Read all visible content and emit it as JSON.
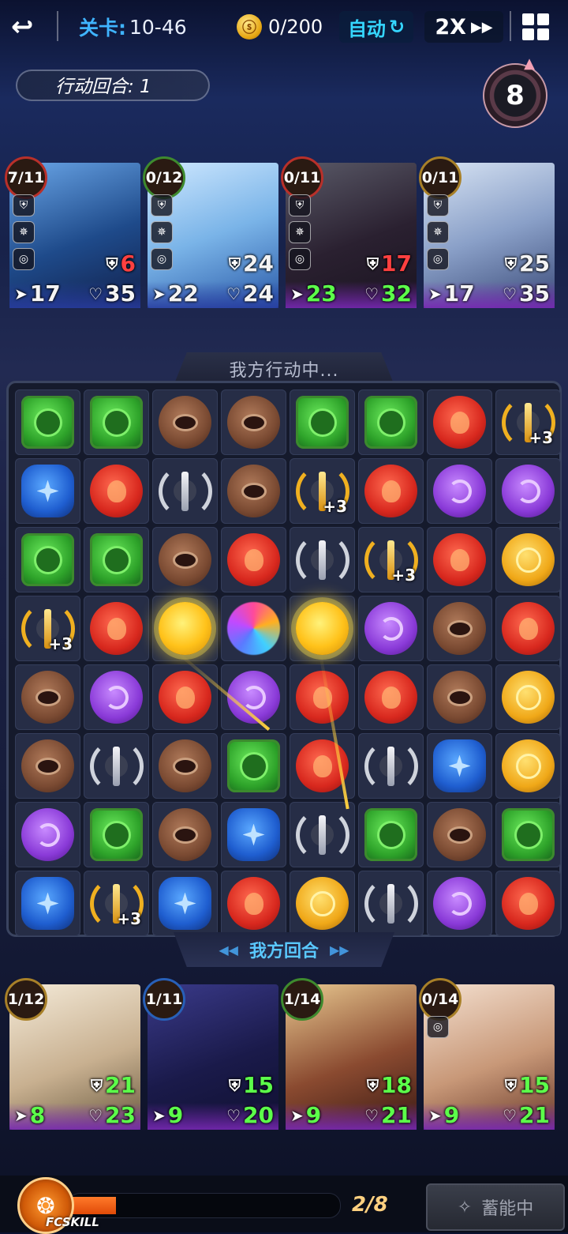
{
  "topbar": {
    "back_icon": "back-arrow-icon",
    "stage_label": "关卡:",
    "stage_value": "10-46",
    "coins": "0/200",
    "auto_label": "自动",
    "speed_label": "2X",
    "menu_icon": "grid-menu-icon"
  },
  "turn_label": "行动回合: 1",
  "round_counter": "8",
  "enemies": [
    {
      "energy": "7/11",
      "def": "6",
      "def_color": "red",
      "spd": "17",
      "hp": "35",
      "hp_color": "white",
      "spd_color": "white",
      "theme": "blue"
    },
    {
      "energy": "0/12",
      "def": "24",
      "def_color": "white",
      "spd": "22",
      "hp": "24",
      "hp_color": "white",
      "spd_color": "white",
      "theme": "blue"
    },
    {
      "energy": "0/11",
      "def": "17",
      "def_color": "red",
      "spd": "23",
      "hp": "32",
      "hp_color": "green",
      "spd_color": "green",
      "theme": "purple"
    },
    {
      "energy": "0/11",
      "def": "25",
      "def_color": "white",
      "spd": "17",
      "hp": "35",
      "hp_color": "white",
      "spd_color": "white",
      "theme": "purple"
    }
  ],
  "action_banner": "我方行动中...",
  "our_turn_banner": "我方回合",
  "board": [
    [
      "green",
      "green",
      "brown",
      "brown",
      "green",
      "green",
      "red",
      "gsword+3"
    ],
    [
      "blue",
      "red",
      "sword",
      "brown",
      "gsword+3",
      "red",
      "purple",
      "purple"
    ],
    [
      "green",
      "green",
      "brown",
      "red",
      "sword",
      "gsword+3",
      "red",
      "yellow"
    ],
    [
      "gsword+3",
      "red",
      "hilite",
      "rainbow",
      "hilite",
      "purple",
      "brown",
      "red"
    ],
    [
      "brown",
      "purple",
      "red",
      "purple",
      "red",
      "red",
      "brown",
      "yellow"
    ],
    [
      "brown",
      "sword",
      "brown",
      "green",
      "red",
      "sword",
      "blue",
      "yellow"
    ],
    [
      "purple",
      "green",
      "brown",
      "blue",
      "sword",
      "green",
      "brown",
      "green"
    ],
    [
      "blue",
      "gsword+3",
      "blue",
      "red",
      "yellow",
      "sword",
      "purple",
      "red"
    ]
  ],
  "plus_label": "+3",
  "allies": [
    {
      "energy": "1/12",
      "def": "21",
      "spd": "8",
      "hp": "23"
    },
    {
      "energy": "1/11",
      "def": "15",
      "spd": "9",
      "hp": "20"
    },
    {
      "energy": "1/14",
      "def": "18",
      "spd": "9",
      "hp": "21"
    },
    {
      "energy": "0/14",
      "def": "15",
      "spd": "9",
      "hp": "21"
    }
  ],
  "skill": {
    "logo_text": "FCSKILL",
    "progress": "2/8",
    "progress_fraction": 0.25,
    "button_label": "蓄能中"
  }
}
